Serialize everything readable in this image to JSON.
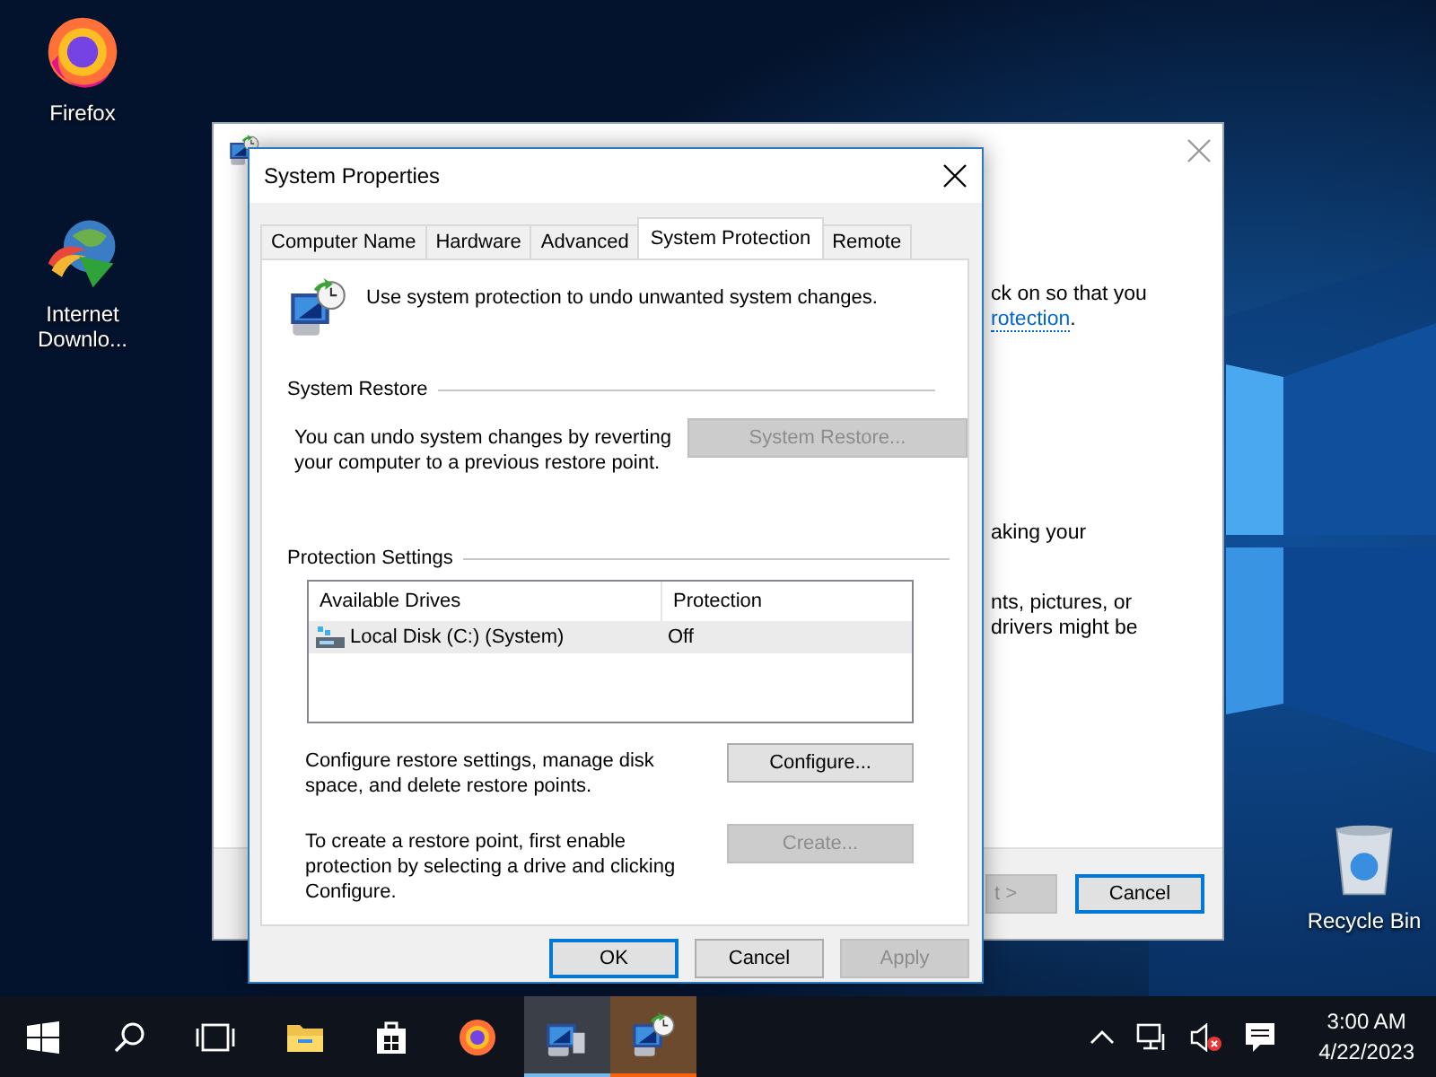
{
  "desktop_icons": [
    {
      "kind": "firefox",
      "label": "Firefox"
    },
    {
      "kind": "downloader",
      "label": "Internet Downlo..."
    },
    {
      "kind": "recycle-bin",
      "label": "Recycle Bin"
    }
  ],
  "background_window": {
    "paragraphs": [
      [
        {
          "kind": "text",
          "text": "ck on so that you"
        },
        {
          "kind": "link",
          "text": "rotection",
          "after": "."
        }
      ],
      [
        {
          "kind": "text",
          "text": "aking your"
        }
      ],
      [
        {
          "kind": "text",
          "text": "nts, pictures, or"
        },
        {
          "kind": "text",
          "text": "drivers might be"
        }
      ]
    ],
    "buttons": [
      {
        "label": "t >",
        "disabled": true,
        "default": false
      },
      {
        "label": "Cancel",
        "disabled": false,
        "default": true
      }
    ]
  },
  "dialog": {
    "title": "System Properties",
    "tabs": [
      {
        "label": "Computer Name",
        "selected": false
      },
      {
        "label": "Hardware",
        "selected": false
      },
      {
        "label": "Advanced",
        "selected": false
      },
      {
        "label": "System Protection",
        "selected": true
      },
      {
        "label": "Remote",
        "selected": false
      }
    ],
    "intro": "Use system protection to undo unwanted system changes.",
    "system_restore": {
      "heading": "System Restore",
      "text": "You can undo system changes by reverting your computer to a previous restore point.",
      "button": {
        "label": "System Restore...",
        "disabled": true
      }
    },
    "protection_settings": {
      "heading": "Protection Settings",
      "columns": [
        "Available Drives",
        "Protection"
      ],
      "rows": [
        {
          "drive": "Local Disk (C:) (System)",
          "protection": "Off",
          "hovered": true
        }
      ],
      "actions": [
        {
          "text": "Configure restore settings, manage disk space, and delete restore points.",
          "button": {
            "label": "Configure...",
            "disabled": false
          }
        },
        {
          "text": "To create a restore point, first enable protection by selecting a drive and clicking Configure.",
          "button": {
            "label": "Create...",
            "disabled": true
          }
        }
      ]
    },
    "buttons": [
      {
        "label": "OK",
        "disabled": false,
        "default": true
      },
      {
        "label": "Cancel",
        "disabled": false,
        "default": false
      },
      {
        "label": "Apply",
        "disabled": true,
        "default": false
      }
    ]
  },
  "taskbar": {
    "items": [
      {
        "kind": "start",
        "focused": false,
        "attention": false
      },
      {
        "kind": "search",
        "focused": false,
        "attention": false
      },
      {
        "kind": "task-view",
        "focused": false,
        "attention": false
      },
      {
        "kind": "explorer",
        "focused": false,
        "attention": false
      },
      {
        "kind": "store",
        "focused": false,
        "attention": false
      },
      {
        "kind": "firefox",
        "focused": false,
        "attention": false
      },
      {
        "kind": "system-properties",
        "focused": true,
        "attention": false
      },
      {
        "kind": "system-restore",
        "focused": false,
        "attention": true
      }
    ],
    "tray": [
      {
        "kind": "chevron"
      },
      {
        "kind": "network"
      },
      {
        "kind": "volume-muted"
      },
      {
        "kind": "notifications"
      }
    ],
    "clock": {
      "time": "3:00 AM",
      "date": "4/22/2023"
    }
  }
}
